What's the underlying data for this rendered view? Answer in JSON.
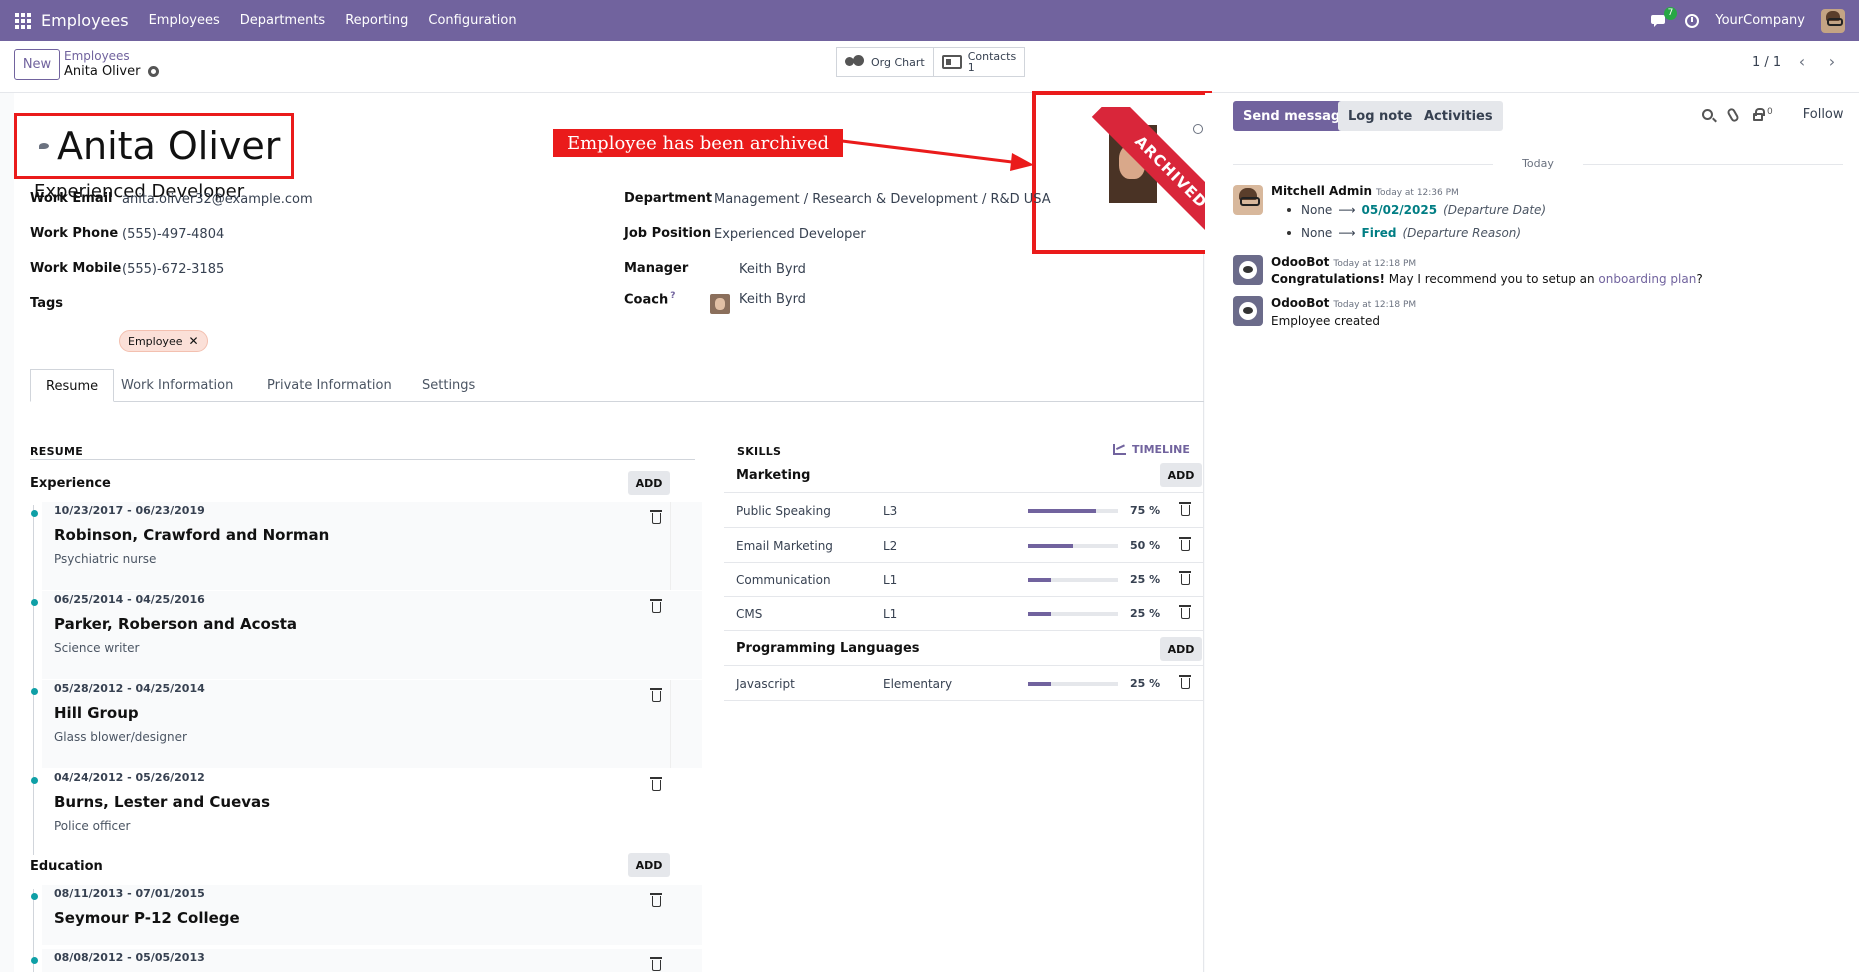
{
  "navbar": {
    "app_name": "Employees",
    "menu": [
      "Employees",
      "Departments",
      "Reporting",
      "Configuration"
    ],
    "notification_count": "7",
    "company": "YourCompany"
  },
  "control_panel": {
    "new_label": "New",
    "breadcrumb_parent": "Employees",
    "breadcrumb_current": "Anita Oliver",
    "smart_buttons": {
      "org_chart": "Org Chart",
      "contacts_label": "Contacts",
      "contacts_count": "1"
    },
    "pager": "1 / 1"
  },
  "employee": {
    "name": "Anita Oliver",
    "job_title": "Experienced Developer",
    "ribbon": "ARCHIVED",
    "annotation": "Employee has been archived",
    "fields": {
      "work_email_label": "Work Email",
      "work_email": "anita.oliver32@example.com",
      "work_phone_label": "Work Phone",
      "work_phone": "(555)-497-4804",
      "work_mobile_label": "Work Mobile",
      "work_mobile": "(555)-672-3185",
      "tags_label": "Tags",
      "tag": "Employee",
      "department_label": "Department",
      "department": "Management / Research & Development / R&D USA",
      "job_position_label": "Job Position",
      "job_position": "Experienced Developer",
      "manager_label": "Manager",
      "manager": "Keith Byrd",
      "coach_label": "Coach",
      "coach_help": "?",
      "coach": "Keith Byrd"
    }
  },
  "tabs": [
    "Resume",
    "Work Information",
    "Private Information",
    "Settings"
  ],
  "resume": {
    "title": "RESUME",
    "experience_label": "Experience",
    "education_label": "Education",
    "add_label": "ADD",
    "experience": [
      {
        "dates": "10/23/2017 - 06/23/2019",
        "company": "Robinson, Crawford and Norman",
        "role": "Psychiatric nurse"
      },
      {
        "dates": "06/25/2014 - 04/25/2016",
        "company": "Parker, Roberson and Acosta",
        "role": "Science writer"
      },
      {
        "dates": "05/28/2012 - 04/25/2014",
        "company": "Hill Group",
        "role": "Glass blower/designer"
      },
      {
        "dates": "04/24/2012 - 05/26/2012",
        "company": "Burns, Lester and Cuevas",
        "role": "Police officer"
      }
    ],
    "education": [
      {
        "dates": "08/11/2013 - 07/01/2015",
        "company": "Seymour P-12 College"
      },
      {
        "dates": "08/08/2012 - 05/05/2013"
      }
    ]
  },
  "skills": {
    "title": "SKILLS",
    "timeline_label": "TIMELINE",
    "add_label": "ADD",
    "categories": [
      {
        "name": "Marketing",
        "items": [
          {
            "name": "Public Speaking",
            "level": "L3",
            "progress": 75,
            "pct": "75 %"
          },
          {
            "name": "Email Marketing",
            "level": "L2",
            "progress": 50,
            "pct": "50 %"
          },
          {
            "name": "Communication",
            "level": "L1",
            "progress": 25,
            "pct": "25 %"
          },
          {
            "name": "CMS",
            "level": "L1",
            "progress": 25,
            "pct": "25 %"
          }
        ]
      },
      {
        "name": "Programming Languages",
        "items": [
          {
            "name": "Javascript",
            "level": "Elementary",
            "progress": 25,
            "pct": "25 %"
          }
        ]
      }
    ]
  },
  "chatter": {
    "send_message": "Send message",
    "log_note": "Log note",
    "activities": "Activities",
    "followers_count": "0",
    "follow": "Follow",
    "today": "Today",
    "messages": [
      {
        "author": "Mitchell Admin",
        "time": "Today at 12:36 PM",
        "tracking": [
          {
            "old": "None",
            "arrow": "⟶",
            "new": "05/02/2025",
            "field": "(Departure Date)"
          },
          {
            "old": "None",
            "arrow": "⟶",
            "new": "Fired",
            "field": "(Departure Reason)"
          }
        ]
      },
      {
        "author": "OdooBot",
        "time": "Today at 12:18 PM",
        "bold": "Congratulations!",
        "text": " May I recommend you to setup an ",
        "link": "onboarding plan",
        "after": "?"
      },
      {
        "author": "OdooBot",
        "time": "Today at 12:18 PM",
        "text": "Employee created"
      }
    ]
  },
  "colors": {
    "brand": "#71639e",
    "annotation_red": "#ea1b1b",
    "ribbon_red": "#d9263a",
    "tracking_teal": "#017e84"
  }
}
